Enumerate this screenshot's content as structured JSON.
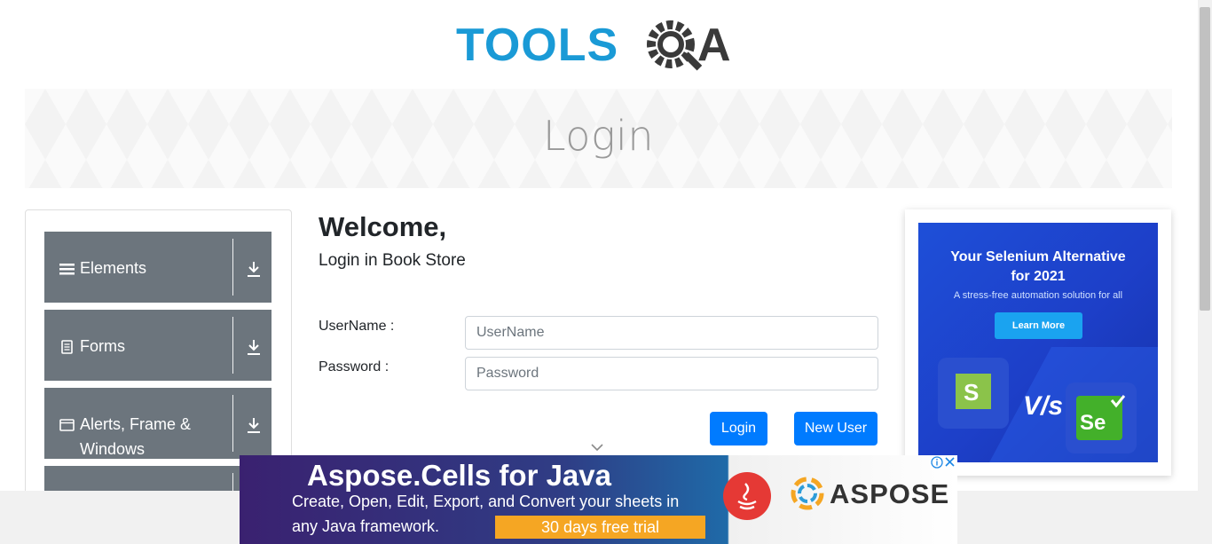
{
  "header": {
    "logo_text_left": "TOOLS",
    "logo_text_right": "QA"
  },
  "banner": {
    "title": "Login"
  },
  "sidebar": {
    "groups": [
      {
        "label": "Elements",
        "icon": "hamburger-icon"
      },
      {
        "label": "Forms",
        "icon": "document-icon"
      },
      {
        "label": "Alerts, Frame & Windows",
        "icon": "window-icon"
      }
    ]
  },
  "main": {
    "heading": "Welcome,",
    "subheading": "Login in Book Store",
    "username_label": "UserName :",
    "username_placeholder": "UserName",
    "username_value": "",
    "password_label": "Password :",
    "password_placeholder": "Password",
    "password_value": "",
    "login_button": "Login",
    "new_user_button": "New User"
  },
  "right_ad": {
    "headline_line1": "Your Selenium Alternative",
    "headline_line2": "for 2021",
    "subline": "A stress-free automation solution for all",
    "cta": "Learn More",
    "vs_text": "V/s",
    "left_logo_letter": "S",
    "right_logo_letters": "Se"
  },
  "bottom_ad": {
    "title": "Aspose.Cells for Java",
    "line1": "Create, Open, Edit, Export, and Convert your sheets in",
    "line2": "any Java framework.",
    "trial": "30 days free trial",
    "brand": "ASPOSE"
  },
  "colors": {
    "primary_button": "#007bff",
    "sidebar_group": "#6c757d",
    "logo_blue": "#1a9ad6",
    "logo_dark": "#3a3a3a"
  }
}
